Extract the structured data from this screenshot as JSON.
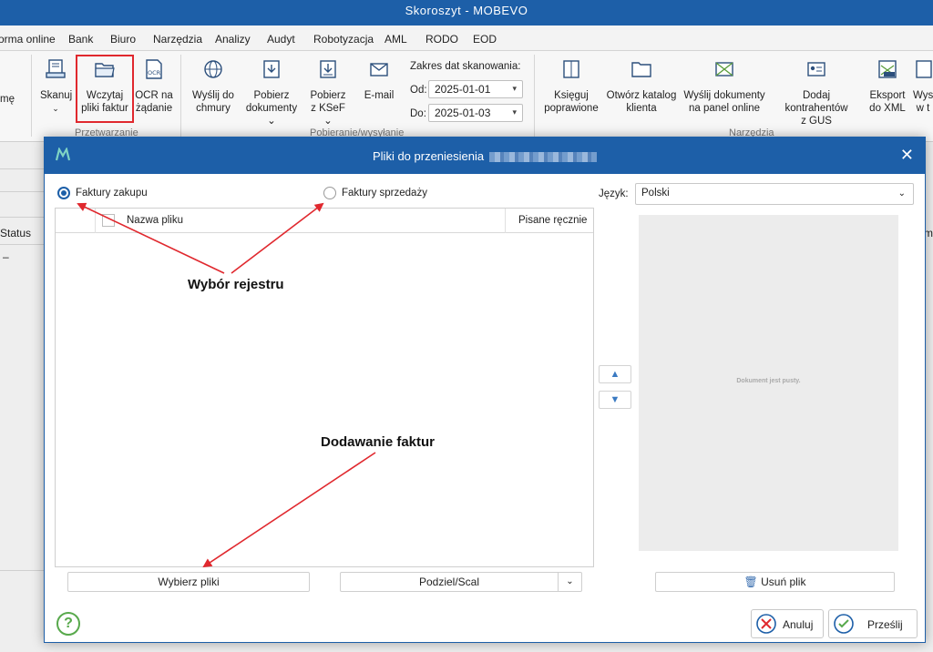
{
  "app": {
    "title": "Skoroszyt -  MOBEVO"
  },
  "menu": [
    "orma online",
    "Bank",
    "Biuro",
    "Narzędzia",
    "Analizy",
    "Audyt",
    "Robotyzacja",
    "AML",
    "RODO",
    "EOD"
  ],
  "ribbon": {
    "left_cut": "mę",
    "buttons": {
      "skanuj": "Skanuj",
      "wczytaj_1": "Wczytaj",
      "wczytaj_2": "pliki faktur",
      "ocr_1": "OCR na",
      "ocr_2": "żądanie",
      "wyslij_chmury_1": "Wyślij do",
      "wyslij_chmury_2": "chmury",
      "pobierz_dok_1": "Pobierz",
      "pobierz_dok_2": "dokumenty",
      "pobierz_ksef_1": "Pobierz",
      "pobierz_ksef_2": "z KSeF",
      "email": "E-mail",
      "ksieguj_1": "Księguj",
      "ksieguj_2": "poprawione",
      "otworz_1": "Otwórz katalog",
      "otworz_2": "klienta",
      "wyslij_panel_1": "Wyślij dokumenty",
      "wyslij_panel_2": "na panel online",
      "dodaj_1": "Dodaj kontrahentów",
      "dodaj_2": "z GUS",
      "eksport_1": "Eksport",
      "eksport_2": "do XML",
      "wys_cut_1": "Wys",
      "wys_cut_2": "w t"
    },
    "date_range": {
      "label": "Zakres dat skanowania:",
      "from_label": "Od:",
      "from_value": "2025-01-01",
      "to_label": "Do:",
      "to_value": "2025-01-03"
    },
    "groups": {
      "przetwarzanie": "Przetwarzanie",
      "pobieranie": "Pobieranie/wysyłanie",
      "narzedzia": "Narzędzia"
    }
  },
  "background": {
    "status_header": "Status",
    "dash": "–",
    "right_cut": "m"
  },
  "dialog": {
    "title": "Pliki do przeniesienia",
    "radios": {
      "zakupu": "Faktury zakupu",
      "sprzedazy": "Faktury sprzedaży",
      "selected": "zakupu"
    },
    "table": {
      "columns": [
        "Nazwa pliku",
        "Pisane ręcznie"
      ],
      "rows": []
    },
    "buttons": {
      "wybierz": "Wybierz pliki",
      "podziel": "Podziel/Scal",
      "usun": "Usuń plik",
      "anuluj": "Anuluj",
      "przeslij": "Prześlij"
    },
    "language": {
      "label": "Język:",
      "value": "Polski"
    },
    "preview": {
      "empty_text": "Dokument jest pusty."
    }
  },
  "annotations": {
    "rejestr": "Wybór rejestru",
    "dodawanie": "Dodawanie faktur"
  },
  "colors": {
    "accent": "#1d5fa8",
    "annotation": "#e0282e",
    "help": "#58a94c"
  }
}
